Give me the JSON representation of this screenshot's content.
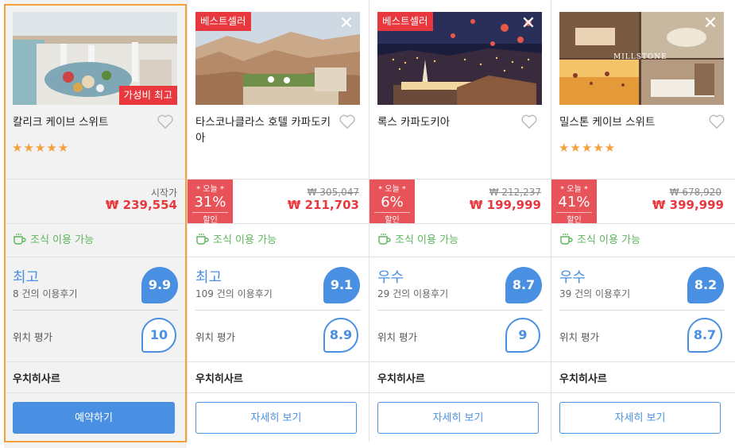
{
  "colors": {
    "accent": "#4a90e2",
    "price_red": "#e8383d",
    "star": "#f5a13b",
    "breakfast_green": "#5bb55b",
    "selected_border": "#f5a13b"
  },
  "hotels": [
    {
      "name": "칼리크 케이브 스위트",
      "photo": "terrace-breakfast",
      "badge_corner": "가성비 최고",
      "stars": "★★★★★",
      "price_label": "시작가",
      "price": "₩ 239,554",
      "breakfast": "조식 이용 가능",
      "rating_word": "최고",
      "review_count": "8 건의 이용후기",
      "score": "9.9",
      "location_label": "위치 평가",
      "location_score": "10",
      "area": "우치히사르",
      "button_label": "예약하기"
    },
    {
      "name": "타스코나클라스 호텔 카파도키아",
      "photo": "valley-terrace",
      "badge_top": "베스트셀러",
      "deal_top": "* 오늘 *",
      "deal_pct": "31%",
      "deal_bottom": "할인",
      "original_price": "₩ 305,047",
      "price": "₩ 211,703",
      "breakfast": "조식 이용 가능",
      "rating_word": "최고",
      "review_count": "109 건의 이용후기",
      "score": "9.1",
      "location_label": "위치 평가",
      "location_score": "8.9",
      "area": "우치히사르",
      "button_label": "자세히 보기"
    },
    {
      "name": "록스 카파도키아",
      "photo": "night-balloons",
      "badge_top": "베스트셀러",
      "deal_top": "* 오늘 *",
      "deal_pct": "6%",
      "deal_bottom": "할인",
      "original_price": "₩ 212,237",
      "price": "₩ 199,999",
      "breakfast": "조식 이용 가능",
      "rating_word": "우수",
      "review_count": "29 건의 이용후기",
      "score": "8.7",
      "location_label": "위치 평가",
      "location_score": "9",
      "area": "우치히사르",
      "button_label": "자세히 보기"
    },
    {
      "name": "밀스톤 케이브 스위트",
      "photo": "cave-suite-collage",
      "photo_logo": "MILLSTONE",
      "stars": "★★★★★",
      "deal_top": "* 오늘 *",
      "deal_pct": "41%",
      "deal_bottom": "할인",
      "original_price": "₩ 678,920",
      "price": "₩ 399,999",
      "breakfast": "조식 이용 가능",
      "rating_word": "우수",
      "review_count": "39 건의 이용후기",
      "score": "8.2",
      "location_label": "위치 평가",
      "location_score": "8.7",
      "area": "우치히사르",
      "button_label": "자세히 보기"
    }
  ]
}
